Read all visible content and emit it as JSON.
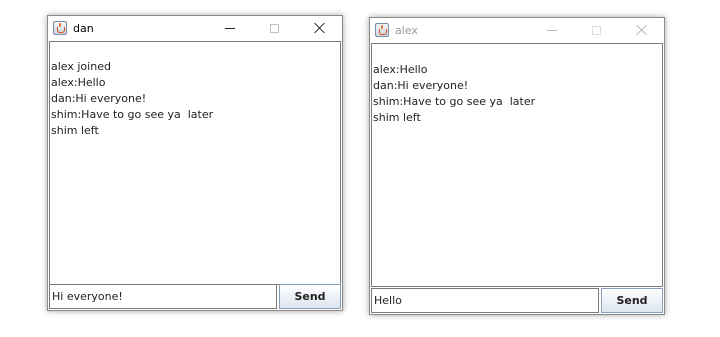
{
  "windows": [
    {
      "title": "dan",
      "active": true,
      "messages": [
        "alex joined",
        "alex:Hello",
        "dan:Hi everyone!",
        "shim:Have to go see ya  later",
        "shim left"
      ],
      "input_value": "Hi everyone!",
      "send_label": "Send"
    },
    {
      "title": "alex",
      "active": false,
      "messages": [
        "alex:Hello",
        "dan:Hi everyone!",
        "shim:Have to go see ya  later",
        "shim left"
      ],
      "input_value": "Hello",
      "send_label": "Send"
    }
  ],
  "icons": {
    "app": "java-cup-icon",
    "minimize": "minimize-icon",
    "maximize": "maximize-icon",
    "close": "close-icon"
  }
}
